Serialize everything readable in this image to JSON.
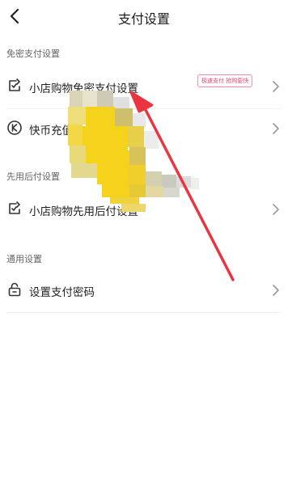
{
  "header": {
    "title": "支付设置",
    "back_icon": "chevron-left-icon"
  },
  "sections": [
    {
      "title": "免密支付设置",
      "items": [
        {
          "label": "小店购物免密支付设置",
          "badge": "极速支付 抢购更快",
          "icon": "wallet-check-icon"
        },
        {
          "label": "快币充值",
          "icon": "k-coin-icon"
        }
      ]
    },
    {
      "title": "先用后付设置",
      "items": [
        {
          "label": "小店购物先用后付设置",
          "icon": "wallet-check-icon"
        }
      ]
    },
    {
      "title": "通用设置",
      "items": [
        {
          "label": "设置支付密码",
          "icon": "lock-icon"
        }
      ]
    }
  ],
  "colors": {
    "badge": "#f0466e",
    "arrow": "#e8353f",
    "mosaic_yellow": "#f5d21b"
  }
}
